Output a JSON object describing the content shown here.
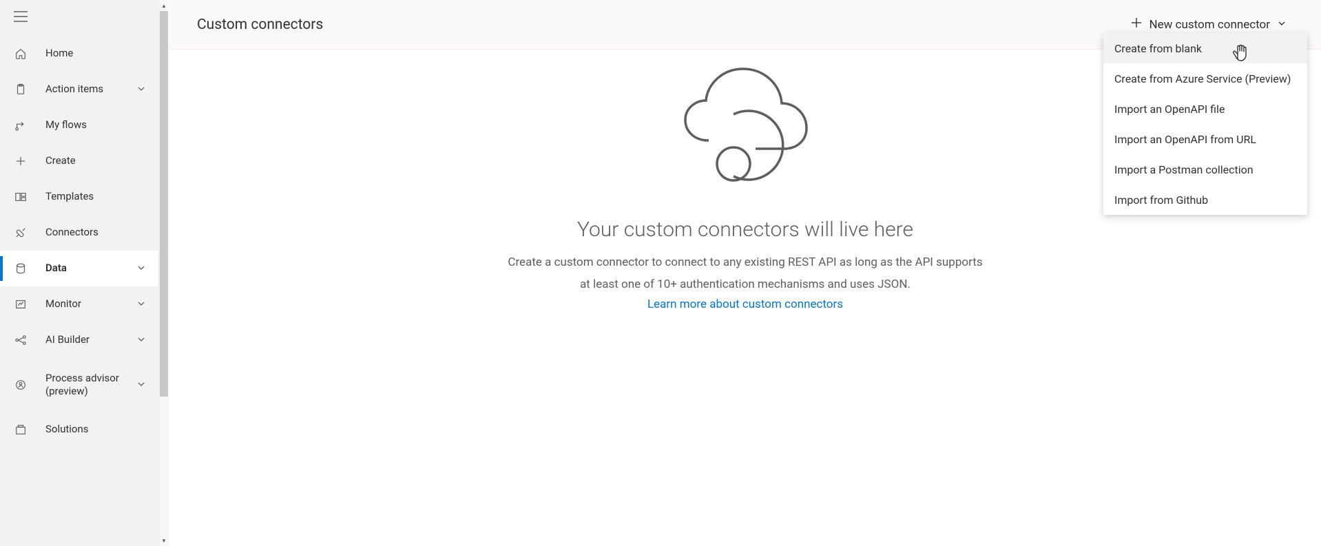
{
  "sidebar": {
    "items": [
      {
        "label": "Home"
      },
      {
        "label": "Action items"
      },
      {
        "label": "My flows"
      },
      {
        "label": "Create"
      },
      {
        "label": "Templates"
      },
      {
        "label": "Connectors"
      },
      {
        "label": "Data"
      },
      {
        "label": "Monitor"
      },
      {
        "label": "AI Builder"
      },
      {
        "label": "Process advisor (preview)"
      },
      {
        "label": "Solutions"
      }
    ]
  },
  "header": {
    "title": "Custom connectors",
    "new_button": "New custom connector"
  },
  "dropdown": {
    "items": [
      "Create from blank",
      "Create from Azure Service (Preview)",
      "Import an OpenAPI file",
      "Import an OpenAPI from URL",
      "Import a Postman collection",
      "Import from Github"
    ]
  },
  "empty_state": {
    "title": "Your custom connectors will live here",
    "desc_line1": "Create a custom connector to connect to any existing REST API as long as the API supports",
    "desc_line2": "at least one of 10+ authentication mechanisms and uses JSON.",
    "link": "Learn more about custom connectors"
  }
}
